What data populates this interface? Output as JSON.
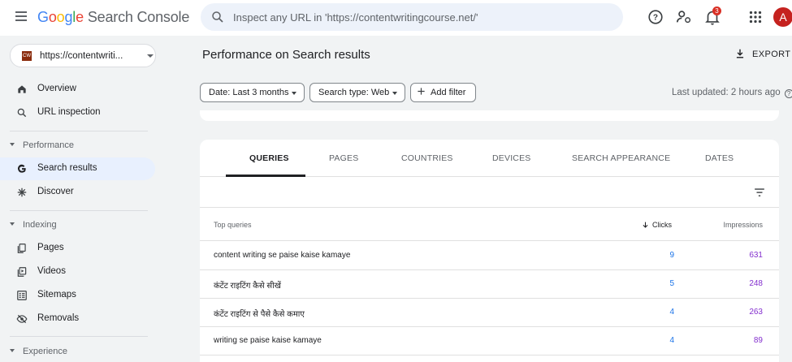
{
  "app": {
    "logo_google": [
      "G",
      "o",
      "o",
      "g",
      "l",
      "e"
    ],
    "logo_product": "Search Console",
    "search_placeholder": "Inspect any URL in 'https://contentwritingcourse.net/'",
    "notification_count": "3",
    "avatar_letter": "A"
  },
  "sidebar": {
    "property_favicon": "CW",
    "property_label": "https://contentwriti...",
    "items": [
      {
        "label": "Overview",
        "icon": "home-icon"
      },
      {
        "label": "URL inspection",
        "icon": "search-icon"
      }
    ],
    "sections": [
      {
        "title": "Performance",
        "items": [
          {
            "label": "Search results",
            "icon": "google-g-icon",
            "active": true
          },
          {
            "label": "Discover",
            "icon": "asterisk-icon"
          }
        ]
      },
      {
        "title": "Indexing",
        "items": [
          {
            "label": "Pages",
            "icon": "pages-icon"
          },
          {
            "label": "Videos",
            "icon": "video-icon"
          },
          {
            "label": "Sitemaps",
            "icon": "sitemap-icon"
          },
          {
            "label": "Removals",
            "icon": "eye-off-icon"
          }
        ]
      },
      {
        "title": "Experience",
        "items": []
      }
    ]
  },
  "header": {
    "title": "Performance on Search results",
    "export_label": "EXPORT",
    "filters": {
      "date": "Date: Last 3 months",
      "search_type": "Search type: Web",
      "add_filter": "Add filter"
    },
    "last_updated": "Last updated: 2 hours ago"
  },
  "tabs": [
    "QUERIES",
    "PAGES",
    "COUNTRIES",
    "DEVICES",
    "SEARCH APPEARANCE",
    "DATES"
  ],
  "active_tab": "QUERIES",
  "table": {
    "columns": {
      "query": "Top queries",
      "clicks": "Clicks",
      "impressions": "Impressions"
    },
    "rows": [
      {
        "query": "content writing se paise kaise kamaye",
        "clicks": "9",
        "impressions": "631"
      },
      {
        "query": "कंटेंट राइटिंग कैसे सीखें",
        "clicks": "5",
        "impressions": "248"
      },
      {
        "query": "कंटेंट राइटिंग से पैसे कैसे कमाए",
        "clicks": "4",
        "impressions": "263"
      },
      {
        "query": "writing se paise kaise kamaye",
        "clicks": "4",
        "impressions": "89"
      }
    ]
  },
  "colors": {
    "active_nav": "#e8f0fe",
    "clicks": "#1a73e8",
    "impressions": "#8430ce",
    "avatar": "#c5221f"
  }
}
